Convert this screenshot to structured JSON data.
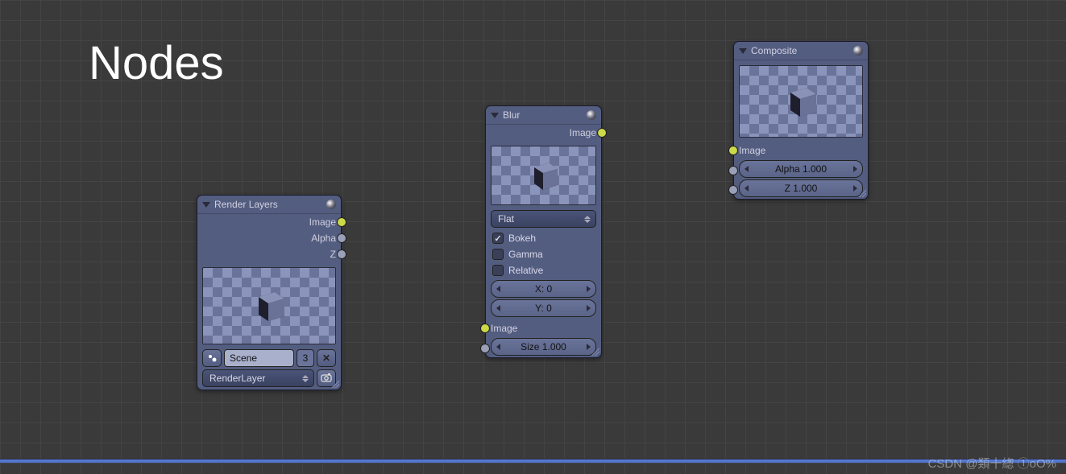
{
  "title": "Nodes",
  "nodes": {
    "render_layers": {
      "header": "Render Layers",
      "outputs": {
        "image": "Image",
        "alpha": "Alpha",
        "z": "Z"
      },
      "scene_field": "Scene",
      "scene_count": "3",
      "layer_field": "RenderLayer"
    },
    "blur": {
      "header": "Blur",
      "outputs": {
        "image": "Image"
      },
      "filter_type": "Flat",
      "bokeh": "Bokeh",
      "gamma": "Gamma",
      "relative": "Relative",
      "x": "X: 0",
      "y": "Y: 0",
      "inputs": {
        "image": "Image",
        "size": "Size 1.000"
      }
    },
    "composite": {
      "header": "Composite",
      "inputs": {
        "image": "Image",
        "alpha": "Alpha 1.000",
        "z": "Z 1.000"
      }
    }
  },
  "watermark": "CSDN @類十緫 ①oO%"
}
